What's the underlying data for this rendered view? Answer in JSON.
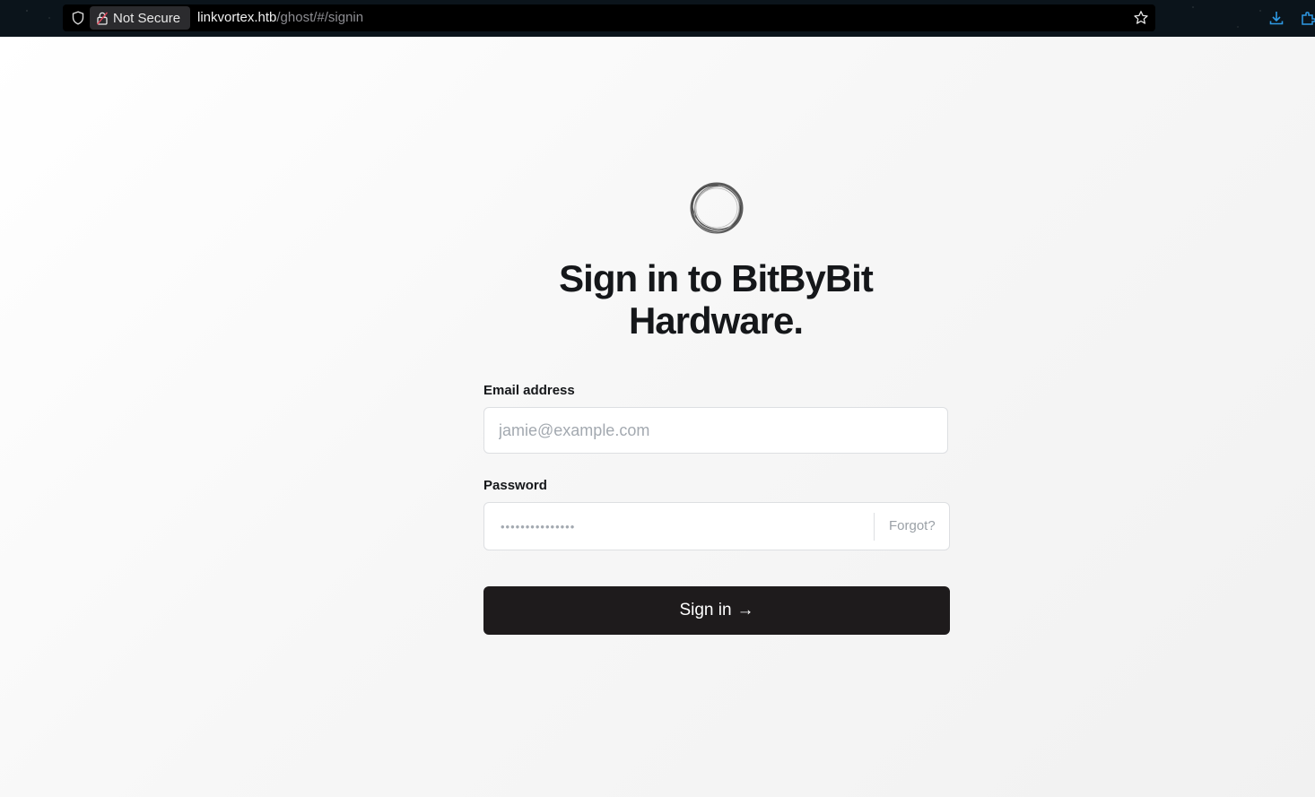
{
  "browser": {
    "security_label": "Not Secure",
    "url_host": "linkvortex.htb",
    "url_path": "/ghost/#/signin",
    "icons": [
      "shield-icon",
      "lock-icon",
      "star-icon",
      "download-icon",
      "extensions-icon"
    ]
  },
  "signin": {
    "title": "Sign in to BitByBit Hardware.",
    "email_label": "Email address",
    "email_placeholder": "jamie@example.com",
    "password_label": "Password",
    "password_dots": "•••••••••••••••",
    "forgot_label": "Forgot?",
    "button_label": "Sign in",
    "button_arrow": "→"
  },
  "colors": {
    "button_bg": "#1e1b1c",
    "chrome_bg": "#0b141b",
    "title_color": "#15171a"
  }
}
